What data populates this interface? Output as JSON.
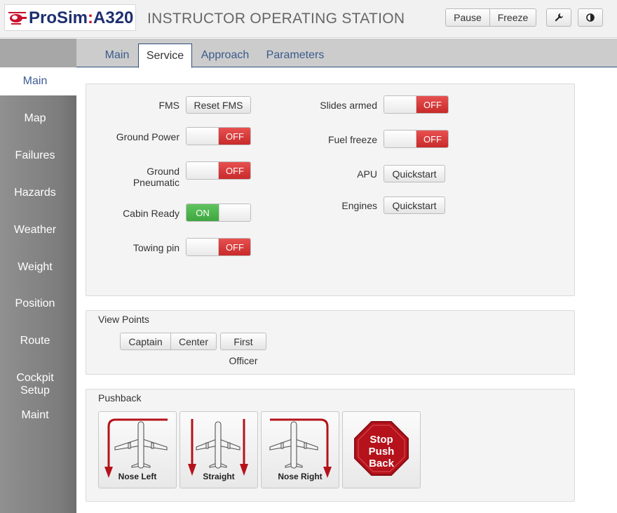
{
  "header": {
    "logo_text_left": "ProSim",
    "logo_colon": ":",
    "logo_text_right": "A320",
    "title": "INSTRUCTOR OPERATING STATION",
    "pause_label": "Pause",
    "freeze_label": "Freeze",
    "wrench_icon": "wrench-icon",
    "contrast_icon": "contrast-icon"
  },
  "sidebar": {
    "items": [
      {
        "label": "Main",
        "active": true
      },
      {
        "label": "Map"
      },
      {
        "label": "Failures"
      },
      {
        "label": "Hazards"
      },
      {
        "label": "Weather"
      },
      {
        "label": "Weight"
      },
      {
        "label": "Position"
      },
      {
        "label": "Route"
      },
      {
        "label": "Cockpit Setup"
      },
      {
        "label": "Maint"
      }
    ]
  },
  "tabs": [
    {
      "label": "Main"
    },
    {
      "label": "Service",
      "active": true
    },
    {
      "label": "Approach"
    },
    {
      "label": "Parameters"
    }
  ],
  "service": {
    "fms": {
      "label": "FMS",
      "button": "Reset FMS"
    },
    "ground_power": {
      "label": "Ground Power",
      "state": "OFF"
    },
    "ground_pneumatic": {
      "label": "Ground Pneumatic",
      "state": "OFF"
    },
    "cabin_ready": {
      "label": "Cabin Ready",
      "state": "ON"
    },
    "towing_pin": {
      "label": "Towing pin",
      "state": "OFF"
    },
    "slides_armed": {
      "label": "Slides armed",
      "state": "OFF"
    },
    "fuel_freeze": {
      "label": "Fuel freeze",
      "state": "OFF"
    },
    "apu": {
      "label": "APU",
      "button": "Quickstart"
    },
    "engines": {
      "label": "Engines",
      "button": "Quickstart"
    }
  },
  "view_points": {
    "title": "View Points",
    "captain": "Captain",
    "center": "Center",
    "first": "First",
    "officer": "Officer"
  },
  "pushback": {
    "title": "Pushback",
    "nose_left": "Nose Left",
    "straight": "Straight",
    "nose_right": "Nose Right",
    "stop_line1": "Stop",
    "stop_line2": "Push",
    "stop_line3": "Back"
  },
  "colors": {
    "off_red": "#d63a3a",
    "on_green": "#4cb34c",
    "accent_blue": "#3a5b8c",
    "stop_red": "#b5121b"
  }
}
